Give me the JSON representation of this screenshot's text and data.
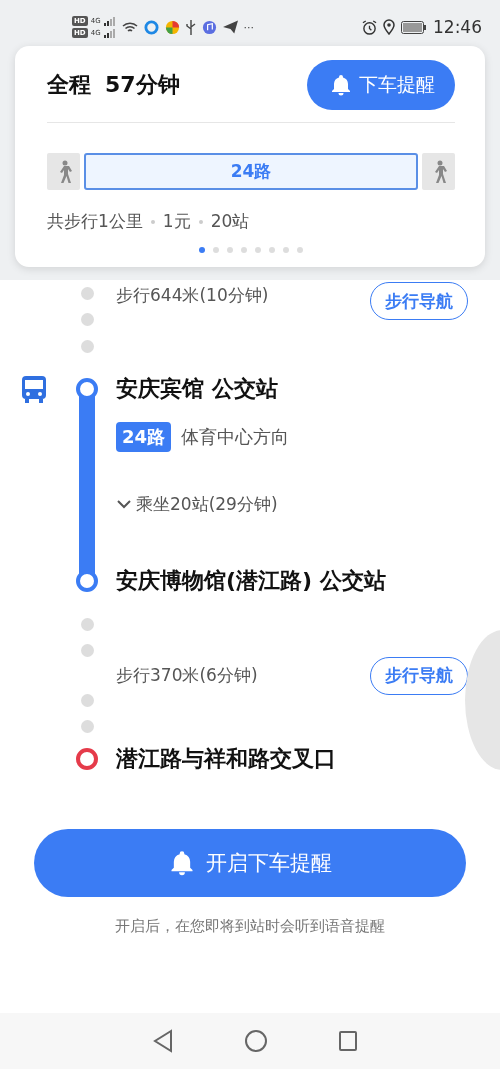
{
  "status_bar": {
    "sims": [
      {
        "badge": "HD",
        "network": "4G"
      },
      {
        "badge": "HD",
        "network": "4G"
      }
    ],
    "more": "···",
    "time": "12:46"
  },
  "summary_card": {
    "label": "全程",
    "duration": "57分钟",
    "remind_button": "下车提醒",
    "segments": [
      {
        "kind": "walk"
      },
      {
        "kind": "bus",
        "label": "24路"
      },
      {
        "kind": "walk"
      }
    ],
    "facts": [
      "共步行1公里",
      "1元",
      "20站"
    ],
    "pager": [
      {
        "selected": true
      },
      {
        "selected": false
      },
      {
        "selected": false
      },
      {
        "selected": false
      },
      {
        "selected": false
      },
      {
        "selected": false
      },
      {
        "selected": false
      },
      {
        "selected": false
      }
    ]
  },
  "steps": [
    {
      "kind": "walk",
      "text": "步行644米(10分钟)",
      "button": "步行导航"
    },
    {
      "kind": "board",
      "name": "安庆宾馆 公交站"
    },
    {
      "kind": "route",
      "badge": "24路",
      "direction": "体育中心方向"
    },
    {
      "kind": "ride",
      "text": "乘坐20站(29分钟)",
      "expanded": false
    },
    {
      "kind": "alight",
      "name": "安庆博物馆(潜江路) 公交站"
    },
    {
      "kind": "walk",
      "text": "步行370米(6分钟)",
      "button": "步行导航"
    },
    {
      "kind": "destination",
      "name": "潜江路与祥和路交叉口"
    }
  ],
  "main_button": "开启下车提醒",
  "hint": "开启后，在您即将到站时会听到语音提醒"
}
